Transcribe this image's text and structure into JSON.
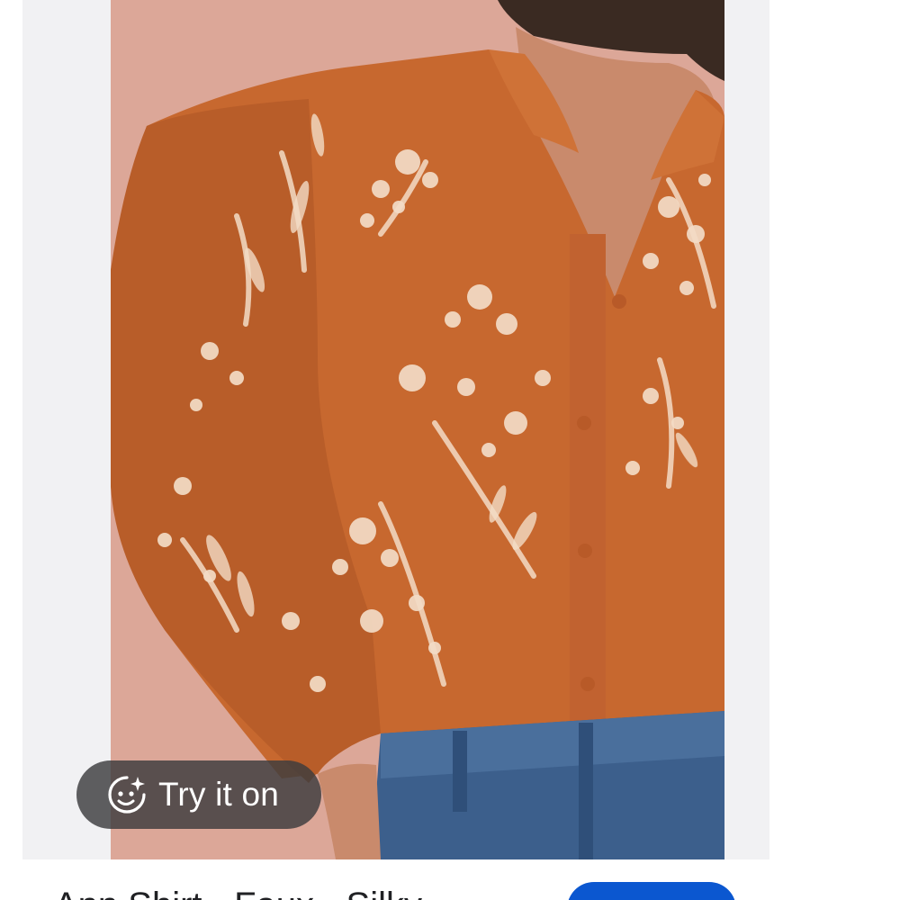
{
  "product_card": {
    "try_on_label": "Try it on",
    "try_on_icon": "face-sparkle-icon"
  },
  "product": {
    "title": "Ann Shirt - Faux - Silky"
  },
  "colors": {
    "shirt": "#c7682f",
    "print": "#f3dcc6",
    "background_wall": "#d9a293",
    "denim": "#3c5f8c",
    "button_blue": "#0b57d0",
    "chip_bg": "#3c3c3e"
  }
}
